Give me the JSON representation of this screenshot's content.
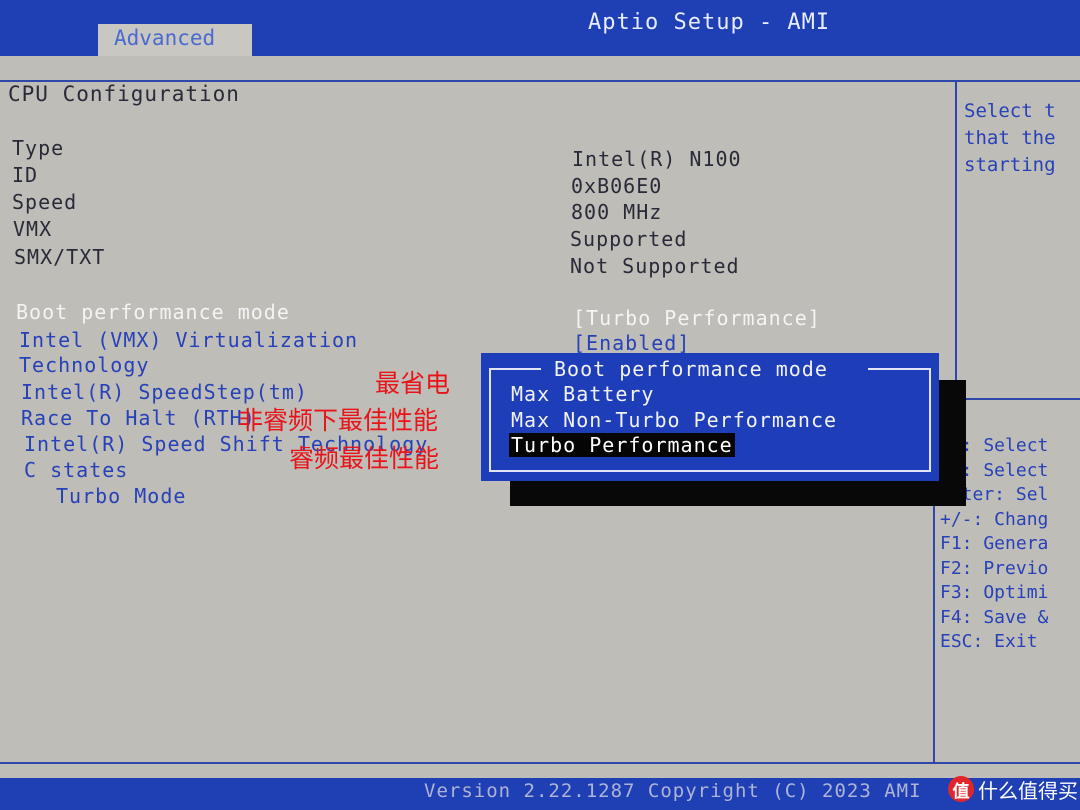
{
  "header": {
    "title": "Aptio Setup - AMI",
    "active_tab": "Advanced"
  },
  "page": {
    "section_title": "CPU Configuration"
  },
  "info_rows": [
    {
      "label": "Type",
      "value": "Intel(R) N100"
    },
    {
      "label": "ID",
      "value": "0xB06E0"
    },
    {
      "label": "Speed",
      "value": "800 MHz"
    },
    {
      "label": "VMX",
      "value": "Supported"
    },
    {
      "label": "SMX/TXT",
      "value": "Not Supported"
    }
  ],
  "settings": [
    {
      "label": "Boot performance mode",
      "value": "[Turbo Performance]"
    },
    {
      "label": "Intel (VMX) Virtualization",
      "value": "[Enabled]"
    },
    {
      "label": "Technology"
    },
    {
      "label": "Intel(R) SpeedStep(tm)"
    },
    {
      "label": "Race To Halt (RTH)"
    },
    {
      "label": "Intel(R) Speed Shift Technology"
    },
    {
      "label": "C states"
    },
    {
      "label": "Turbo Mode"
    }
  ],
  "popup": {
    "title": "Boot performance mode",
    "options": [
      "Max Battery",
      "Max Non-Turbo Performance",
      "Turbo Performance"
    ],
    "selected": "Turbo Performance"
  },
  "annotations": [
    "最省电",
    "非睿频下最佳性能",
    "睿频最佳性能"
  ],
  "help_text": [
    "Select t",
    "that the",
    "starting"
  ],
  "key_help": [
    "←→: Select",
    "↑↓: Select",
    "Enter: Sel",
    "+/-: Chang",
    "F1: Genera",
    "F2: Previo",
    "F3: Optimi",
    "F4: Save &",
    "ESC: Exit"
  ],
  "footer": {
    "version_text": "Version 2.22.1287 Copyright (C) 2023 AMI"
  },
  "watermark": {
    "logo_char": "值",
    "text": "什么值得买"
  },
  "colors": {
    "bios_blue": "#1f3fb5",
    "panel_gray": "#bfbdb7",
    "text_blue": "#2741b8",
    "annotation_red": "#e8141a"
  }
}
